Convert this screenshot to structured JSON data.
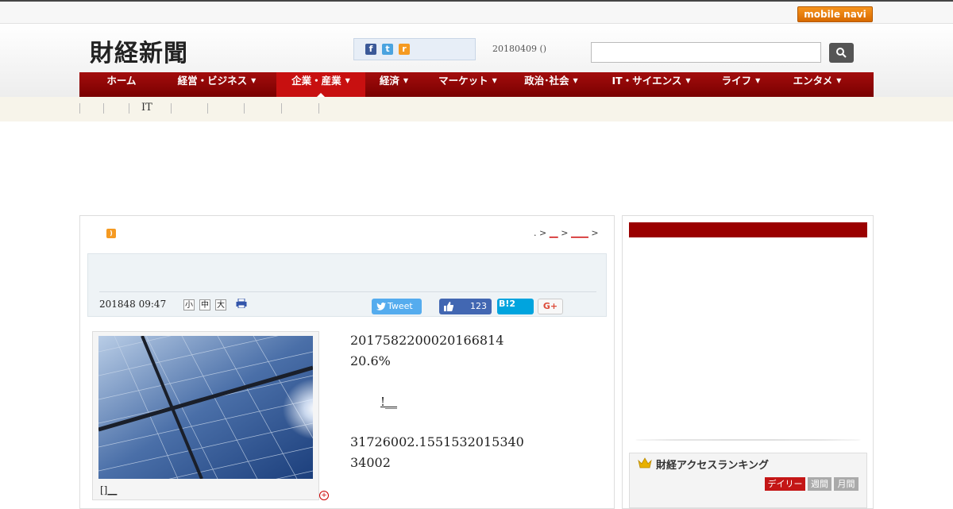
{
  "topbar": {
    "mobile_label": "mobile navi"
  },
  "header": {
    "logo": "財経新聞",
    "date": "20180409 ()",
    "social": {
      "fb": "f",
      "tw": "t",
      "rss": "r"
    }
  },
  "search": {
    "placeholder": ""
  },
  "nav": {
    "items": [
      {
        "label": "ホーム",
        "caret": ""
      },
      {
        "label": "経営・ビジネス",
        "caret": "▼"
      },
      {
        "label": "企業・産業",
        "caret": "▼"
      },
      {
        "label": "経済",
        "caret": "▼"
      },
      {
        "label": "マーケット",
        "caret": "▼"
      },
      {
        "label": "政治･社会",
        "caret": "▼"
      },
      {
        "label": "IT・サイエンス",
        "caret": "▼"
      },
      {
        "label": "ライフ",
        "caret": "▼"
      },
      {
        "label": "エンタメ",
        "caret": "▼"
      }
    ],
    "active_index": 2
  },
  "subnav": {
    "item": "IT"
  },
  "breadcrumb": {
    "prefix": ". > ",
    "link1": "__",
    "sep": " > ",
    "link2": "____",
    "suffix": " >"
  },
  "article": {
    "date": "201848 09:47",
    "font_sizes": [
      "小",
      "中",
      "大"
    ],
    "tweet_label": "Tweet",
    "like_count": "123",
    "hatena_label": "B!",
    "hatena_count": "2",
    "gplus_label": "G+",
    "photo_caption": "[]__",
    "body_lines": [
      "2017582200020166814",
      "20.6%",
      "31726002.1551532015340",
      "34002"
    ],
    "body_link": "!__"
  },
  "sidebar": {
    "ranking_title": "財経アクセスランキング",
    "ranking_tabs": [
      "デイリー",
      "週間",
      "月間"
    ]
  },
  "colors": {
    "nav": "#8b0000",
    "nav_active": "#c81010",
    "accent_red": "#9a0000"
  }
}
